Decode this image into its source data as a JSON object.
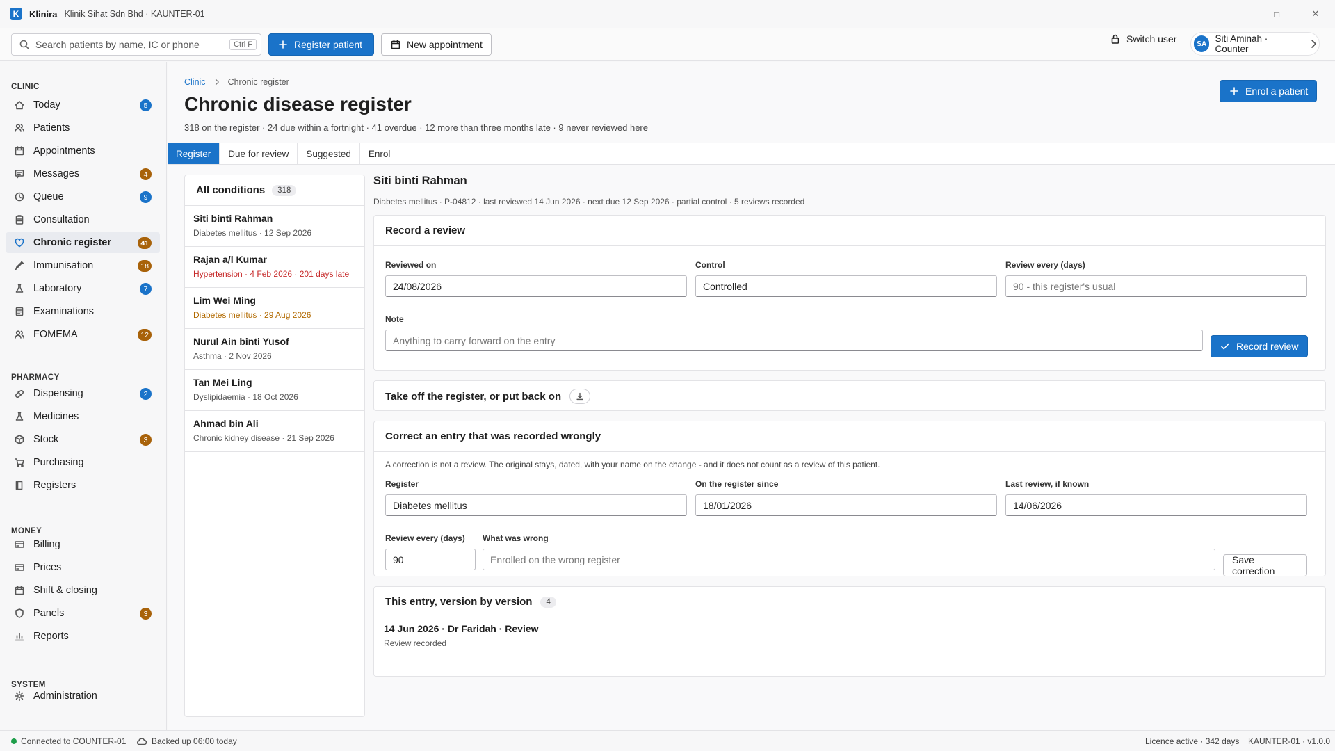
{
  "titlebar": {
    "app_name": "Klinira",
    "subtitle": "Klinik Sihat Sdn Bhd · KAUNTER-01",
    "logo_letter": "K"
  },
  "toolbar": {
    "search_placeholder": "Search patients by name, IC or phone",
    "search_shortcut": "Ctrl F",
    "register_patient": "Register patient",
    "new_appointment": "New appointment",
    "switch_user": "Switch user",
    "user_initials": "SA",
    "user_label": "Siti Aminah · Counter"
  },
  "sidebar": {
    "sections": {
      "clinic": "CLINIC",
      "pharmacy": "PHARMACY",
      "money": "MONEY",
      "system": "SYSTEM"
    },
    "items": [
      {
        "label": "Today",
        "badge": "5",
        "badge_color": "#1a73c9"
      },
      {
        "label": "Patients",
        "badge": "",
        "badge_color": ""
      },
      {
        "label": "Appointments",
        "badge": "",
        "badge_color": ""
      },
      {
        "label": "Messages",
        "badge": "4",
        "badge_color": "#a8620a"
      },
      {
        "label": "Queue",
        "badge": "9",
        "badge_color": "#1a73c9"
      },
      {
        "label": "Consultation",
        "badge": "",
        "badge_color": ""
      },
      {
        "label": "Chronic register",
        "badge": "41",
        "badge_color": "#a8620a"
      },
      {
        "label": "Immunisation",
        "badge": "18",
        "badge_color": "#a8620a"
      },
      {
        "label": "Laboratory",
        "badge": "7",
        "badge_color": "#1a73c9"
      },
      {
        "label": "Examinations",
        "badge": "",
        "badge_color": ""
      },
      {
        "label": "FOMEMA",
        "badge": "12",
        "badge_color": "#a8620a"
      },
      {
        "label": "Dispensing",
        "badge": "2",
        "badge_color": "#1a73c9"
      },
      {
        "label": "Medicines",
        "badge": "",
        "badge_color": ""
      },
      {
        "label": "Stock",
        "badge": "3",
        "badge_color": "#a8620a"
      },
      {
        "label": "Purchasing",
        "badge": "",
        "badge_color": ""
      },
      {
        "label": "Registers",
        "badge": "",
        "badge_color": ""
      },
      {
        "label": "Billing",
        "badge": "",
        "badge_color": ""
      },
      {
        "label": "Prices",
        "badge": "",
        "badge_color": ""
      },
      {
        "label": "Shift & closing",
        "badge": "",
        "badge_color": ""
      },
      {
        "label": "Panels",
        "badge": "3",
        "badge_color": "#a8620a"
      },
      {
        "label": "Reports",
        "badge": "",
        "badge_color": ""
      },
      {
        "label": "Administration",
        "badge": "",
        "badge_color": ""
      }
    ]
  },
  "main": {
    "breadcrumb": {
      "root": "Clinic",
      "current": "Chronic register"
    },
    "title": "Chronic disease register",
    "subtitle": "318 on the register · 24 due within a fortnight · 41 overdue · 12 more than three months late · 9 never reviewed here",
    "enrol_button": "Enrol a patient",
    "tabs": [
      "Register",
      "Due for review",
      "Suggested",
      "Enrol"
    ],
    "list": {
      "title": "All conditions",
      "count": "318",
      "items": [
        {
          "name": "Siti binti Rahman",
          "meta": "Diabetes mellitus · 12 Sep 2026",
          "status": "normal"
        },
        {
          "name": "Rajan a/l Kumar",
          "meta": "Hypertension · 4 Feb 2026 · 201 days late",
          "status": "overdue"
        },
        {
          "name": "Lim Wei Ming",
          "meta": "Diabetes mellitus · 29 Aug 2026",
          "status": "due"
        },
        {
          "name": "Nurul Ain binti Yusof",
          "meta": "Asthma · 2 Nov 2026",
          "status": "normal"
        },
        {
          "name": "Tan Mei Ling",
          "meta": "Dyslipidaemia · 18 Oct 2026",
          "status": "normal"
        },
        {
          "name": "Ahmad bin Ali",
          "meta": "Chronic kidney disease · 21 Sep 2026",
          "status": "normal"
        }
      ]
    },
    "detail": {
      "name": "Siti binti Rahman",
      "meta": "Diabetes mellitus · P-04812 · last reviewed 14 Jun 2026 · next due 12 Sep 2026 · partial control · 5 reviews recorded",
      "record": {
        "title": "Record a review",
        "reviewed_on_label": "Reviewed on",
        "reviewed_on_value": "24/08/2026",
        "control_label": "Control",
        "control_value": "Controlled",
        "interval_label": "Review every (days)",
        "interval_placeholder": "90 - this register's usual",
        "note_label": "Note",
        "note_placeholder": "Anything to carry forward on the entry",
        "submit": "Record review"
      },
      "offregister": {
        "title": "Take off the register, or put back on"
      },
      "correct": {
        "title": "Correct an entry that was recorded wrongly",
        "note": "A correction is not a review. The original stays, dated, with your name on the change - and it does not count as a review of this patient.",
        "register_label": "Register",
        "register_value": "Diabetes mellitus",
        "since_label": "On the register since",
        "since_value": "18/01/2026",
        "last_label": "Last review, if known",
        "last_value": "14/06/2026",
        "interval_label": "Review every (days)",
        "interval_value": "90",
        "wrong_label": "What was wrong",
        "wrong_placeholder": "Enrolled on the wrong register",
        "save": "Save correction"
      },
      "versions": {
        "title": "This entry, version by version",
        "count": "4",
        "first_title": "14 Jun 2026 · Dr Faridah · Review",
        "first_sub": "Review recorded"
      }
    }
  },
  "statusbar": {
    "connection": "Connected to COUNTER-01",
    "backup": "Backed up 06:00 today",
    "licence": "Licence active · 342 days",
    "version": "KAUNTER-01 · v1.0.0"
  }
}
